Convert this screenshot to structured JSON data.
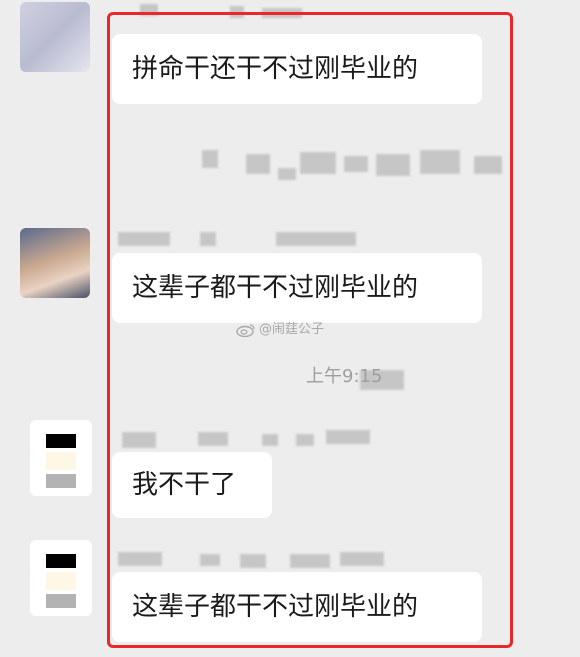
{
  "messages": [
    {
      "text": "拼命干还干不过刚毕业的"
    },
    {
      "text": "这辈子都干不过刚毕业的"
    },
    {
      "text": "我不干了"
    },
    {
      "text": "这辈子都干不过刚毕业的"
    }
  ],
  "timestamp": "上午9:15",
  "watermark": "@闹莛公子",
  "colors": {
    "background": "#ededed",
    "bubble": "#ffffff",
    "highlight": "#e8282b"
  },
  "icons": {
    "watermark": "weibo-logo-icon"
  }
}
